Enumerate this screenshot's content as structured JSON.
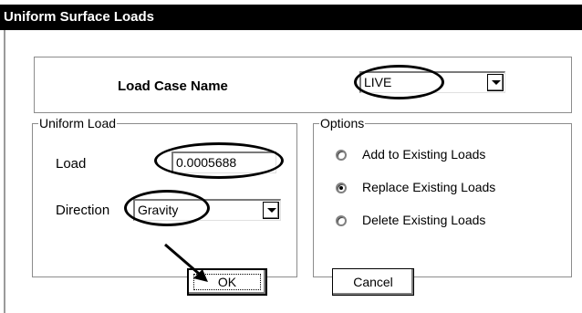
{
  "window": {
    "title": "Uniform Surface Loads"
  },
  "load_case": {
    "label": "Load Case Name",
    "value": "LIVE"
  },
  "uniform_load": {
    "group_title": "Uniform Load",
    "load_label": "Load",
    "load_value": "0.0005688",
    "direction_label": "Direction",
    "direction_value": "Gravity"
  },
  "options": {
    "group_title": "Options",
    "items": [
      {
        "label": "Add to Existing Loads",
        "selected": false
      },
      {
        "label": "Replace Existing Loads",
        "selected": true
      },
      {
        "label": "Delete Existing Loads",
        "selected": false
      }
    ]
  },
  "buttons": {
    "ok_label": "OK",
    "cancel_label": "Cancel"
  }
}
